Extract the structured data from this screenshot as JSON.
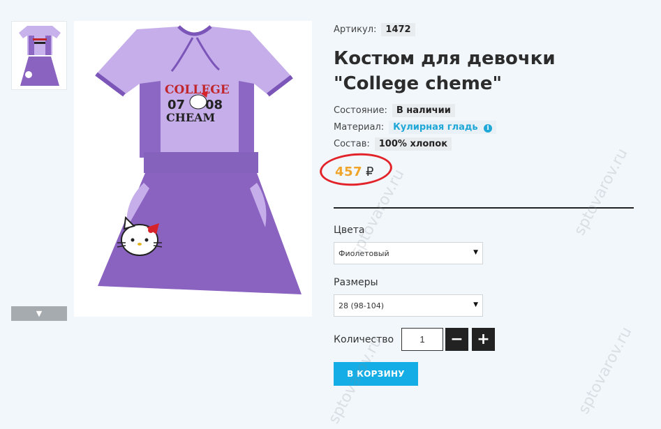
{
  "product": {
    "article_label": "Артикул:",
    "article_value": "1472",
    "title": "Костюм для девочки \"College cheme\"",
    "state_label": "Состояние:",
    "state_value": "В наличии",
    "material_label": "Материал:",
    "material_value": "Кулирная гладь",
    "composition_label": "Состав:",
    "composition_value": "100% хлопок",
    "price": "457",
    "currency": "₽"
  },
  "image_text": {
    "college": "COLLEGE",
    "n07": "07",
    "n08": "08",
    "cheam": "CHEAM"
  },
  "options": {
    "colors_label": "Цвета",
    "colors_selected": "Фиолетовый",
    "sizes_label": "Размеры",
    "sizes_selected": "28 (98-104)"
  },
  "quantity": {
    "label": "Количество",
    "value": "1",
    "minus": "−",
    "plus": "+"
  },
  "cart_button_label": "В КОРЗИНУ",
  "watermark": "sptovarov.ru",
  "colors": {
    "accent": "#15ade6",
    "price": "#f0a52a",
    "circle": "#e3232a",
    "garment": "#8a62c0"
  }
}
